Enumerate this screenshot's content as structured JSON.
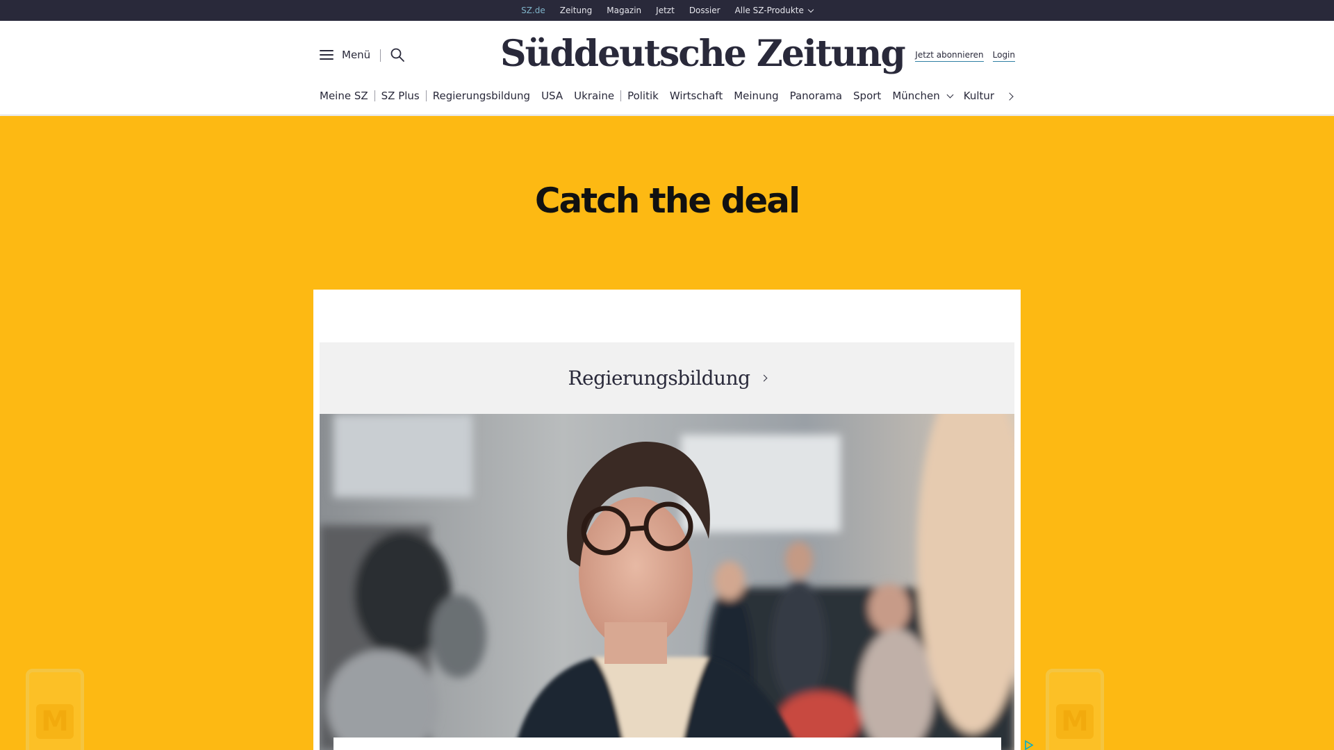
{
  "topbar": {
    "items": [
      "SZ.de",
      "Zeitung",
      "Magazin",
      "Jetzt",
      "Dossier",
      "Alle SZ-Produkte"
    ],
    "active": "SZ.de"
  },
  "header": {
    "menu_label": "Menü",
    "logo_text": "Süddeutsche Zeitung",
    "subscribe_label": "Jetzt abonnieren",
    "login_label": "Login"
  },
  "nav": {
    "items": [
      "Meine SZ",
      "SZ Plus",
      "Regierungsbildung",
      "USA",
      "Ukraine",
      "Politik",
      "Wirtschaft",
      "Meinung",
      "Panorama",
      "Sport",
      "München",
      "Kultur"
    ]
  },
  "ad": {
    "headline": "Catch the deal",
    "accent_color": "#fdb913",
    "phone_logo": "M"
  },
  "article": {
    "topic_label": "Regierungsbildung",
    "photo_icon": "portrait-photo"
  },
  "colors": {
    "topbar_bg": "#29293a",
    "text_dark": "#29293a",
    "active_link": "#7fb3c9",
    "link_underline": "#2f7fa3"
  }
}
